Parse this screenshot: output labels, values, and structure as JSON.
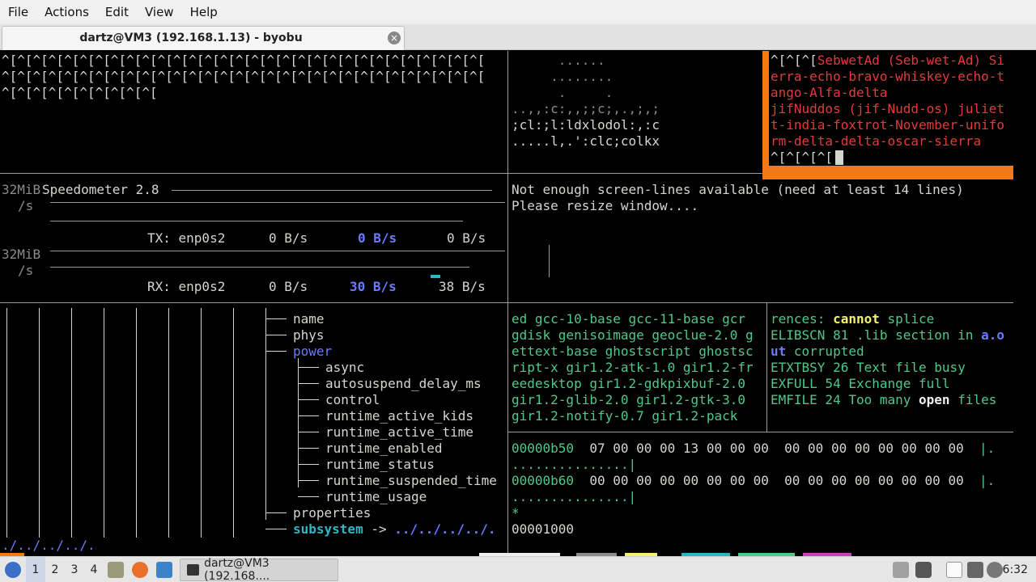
{
  "menu": [
    "File",
    "Actions",
    "Edit",
    "View",
    "Help"
  ],
  "tab": {
    "title": "dartz@VM3 (192.168.1.13) - byobu",
    "close_glyph": "×"
  },
  "top_left": {
    "line1": "^[^[^[^[^[^[^[^[^[^[^[^[^[^[^[^[^[^[^[^[^[^[^[^[^[^[^[^[^[^[^[",
    "line2": "^[^[^[^[^[^[^[^[^[^[^[^[^[^[^[^[^[^[^[^[^[^[^[^[^[^[^[^[^[^[^[",
    "line3": "^[^[^[^[^[^[^[^[^[^["
  },
  "top_mid": {
    "line1": "      ......",
    "line2": "     ........",
    "line3": "      .     .",
    "line4": "..,,:c:,,;;c;,.,;,;",
    "line5": ";cl:;l:ldxlodol:,:c",
    "line6": ".....l,.':clc;colkx"
  },
  "top_right": {
    "l1_prefix": "^[^[^[",
    "l1_red": "SebwetAd (Seb-wet-Ad) Si",
    "l2": "erra-echo-bravo-whiskey-echo-t",
    "l3": "ango-Alfa-delta",
    "l4": "jifNuddos (jif-Nudd-os) juliet",
    "l5": "t-india-foxtrot-November-unifo",
    "l6": "rm-delta-delta-oscar-sierra",
    "l7": "^[^[^[^["
  },
  "speed": {
    "tx_scale": "32MiB",
    "tx_unit": "/s",
    "title": "Speedometer 2.8",
    "tx_label": "TX: enp0s2",
    "tx_v1": "0 B/s",
    "tx_v2": "0 B/s",
    "tx_v3": "0 B/s",
    "rx_scale": "32MiB",
    "rx_unit": "/s",
    "rx_label": "RX: enp0s2",
    "rx_v1": "0 B/s",
    "rx_v2": "30 B/s",
    "rx_v3": "38 B/s"
  },
  "warning": {
    "line1": "Not enough screen-lines available (need at least 14 lines)",
    "line2": "Please resize window...."
  },
  "tree": {
    "name": "name",
    "phys": "phys",
    "power": "power",
    "async": "async",
    "autosuspend": "autosuspend_delay_ms",
    "control": "control",
    "rak": "runtime_active_kids",
    "rat": "runtime_active_time",
    "re": "runtime_enabled",
    "rs": "runtime_status",
    "rst": "runtime_suspended_time",
    "ru": "runtime_usage",
    "properties": "properties",
    "subsystem": "subsystem",
    "arrow": "->",
    "link": "../../../../.",
    "bottom": "./../../../."
  },
  "packages": {
    "l1": "ed gcc-10-base gcc-11-base gcr",
    "l2": "gdisk genisoimage geoclue-2.0 g",
    "l3": "ettext-base ghostscript ghostsc",
    "l4": "ript-x gir1.2-atk-1.0 gir1.2-fr",
    "l5": "eedesktop gir1.2-gdkpixbuf-2.0",
    "l6": "gir1.2-glib-2.0 gir1.2-gtk-3.0",
    "l7": "gir1.2-notify-0.7 gir1.2-pack"
  },
  "errors": {
    "l1a": "rences: ",
    "l1b": "cannot",
    "l1c": " splice",
    "l2a": "ELIBSCN 81 .lib section in ",
    "l2b": "a.o",
    "l3a": "ut",
    "l3b": " corrupted",
    "l4": "ETXTBSY 26 Text file busy",
    "l5": "EXFULL 54 Exchange full",
    "l6a": "EMFILE 24 Too many ",
    "l6b": "open",
    "l6c": " files"
  },
  "hexdump": {
    "addr1": "00000b50",
    "bytes1": "  07 00 00 00 13 00 00 00  00 00 00 00 00 00 00 00  ",
    "pipe1": "|.",
    "ascii1": "...............|",
    "addr2": "00000b60",
    "bytes2": "  00 00 00 00 00 00 00 00  00 00 00 00 00 00 00 00  ",
    "pipe2": "|.",
    "ascii2": "...............|",
    "star": "*",
    "end": "00001000"
  },
  "taskbar": {
    "workspaces": [
      "1",
      "2",
      "3",
      "4"
    ],
    "app_label": "dartz@VM3 (192.168....",
    "clock": "6:32"
  },
  "colors": {
    "orange_border": "#f07a18",
    "link_blue": "#6a7bff",
    "error_red": "#e23b3b",
    "pkg_green": "#4ec98a",
    "hex_cyan": "#2fb6c4"
  }
}
